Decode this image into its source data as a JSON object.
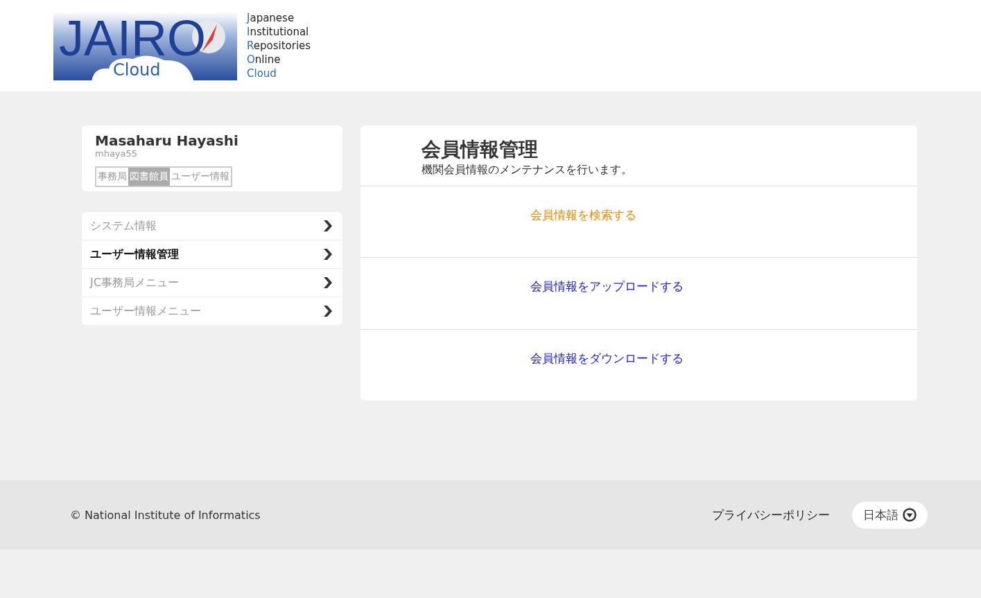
{
  "logo": {
    "title": "JAIRO",
    "subtitle": "Cloud",
    "expansion": [
      "Japanese",
      "Institutional",
      "Repositories",
      "Online",
      "Cloud"
    ]
  },
  "profile": {
    "name": "Masaharu Hayashi",
    "user_id": "mhaya55",
    "roles": [
      {
        "label": "事務局",
        "selected": false
      },
      {
        "label": "図書館員",
        "selected": true
      },
      {
        "label": "ユーザー情報",
        "selected": false
      }
    ]
  },
  "menu": [
    {
      "label": "システム情報",
      "selected": false
    },
    {
      "label": "ユーザー情報管理",
      "selected": true
    },
    {
      "label": "JC事務局メニュー",
      "selected": false
    },
    {
      "label": "ユーザー情報メニュー",
      "selected": false
    }
  ],
  "panel": {
    "title": "会員情報管理",
    "description": "機関会員情報のメンテナンスを行います。",
    "links": [
      {
        "label": "会員情報を検索する",
        "color": "#ee8a00"
      },
      {
        "label": "会員情報をアップロードする",
        "color": "#1a1aee"
      },
      {
        "label": "会員情報をダウンロードする",
        "color": "#1a1aee"
      }
    ]
  },
  "footer": {
    "copyright": "© National Institute of Informatics",
    "privacy_link": "プライバシーポリシー",
    "language": "日本語"
  }
}
